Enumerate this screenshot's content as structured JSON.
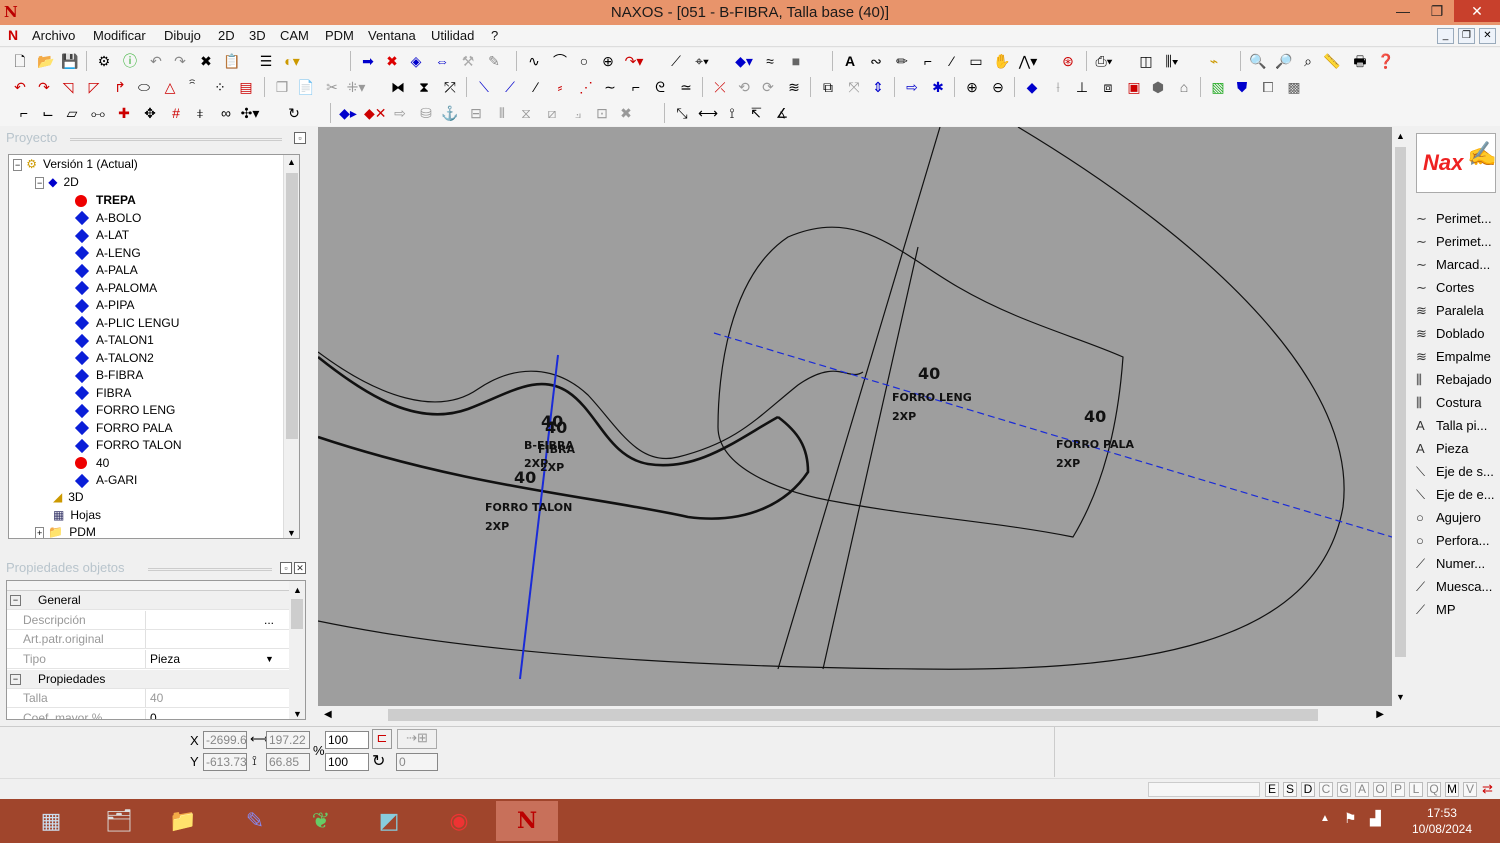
{
  "window": {
    "title": "NAXOS - [051 - B-FIBRA, Talla base (40)]"
  },
  "menu": [
    "Archivo",
    "Modificar",
    "Dibujo",
    "2D",
    "3D",
    "CAM",
    "PDM",
    "Ventana",
    "Utilidad",
    "?"
  ],
  "project_panel": {
    "title": "Proyecto",
    "root": "Versión 1 (Actual)",
    "folder_2d": "2D",
    "items": [
      {
        "label": "TREPA",
        "icon": "red-dot",
        "bold": true
      },
      {
        "label": "A-BOLO",
        "icon": "blue-diamond"
      },
      {
        "label": "A-LAT",
        "icon": "blue-diamond"
      },
      {
        "label": "A-LENG",
        "icon": "blue-diamond"
      },
      {
        "label": "A-PALA",
        "icon": "blue-diamond"
      },
      {
        "label": "A-PALOMA",
        "icon": "blue-diamond"
      },
      {
        "label": "A-PIPA",
        "icon": "blue-diamond"
      },
      {
        "label": "A-PLIC LENGU",
        "icon": "blue-diamond"
      },
      {
        "label": "A-TALON1",
        "icon": "blue-diamond"
      },
      {
        "label": "A-TALON2",
        "icon": "blue-diamond"
      },
      {
        "label": "B-FIBRA",
        "icon": "blue-diamond"
      },
      {
        "label": "FIBRA",
        "icon": "blue-diamond"
      },
      {
        "label": "FORRO LENG",
        "icon": "blue-diamond"
      },
      {
        "label": "FORRO PALA",
        "icon": "blue-diamond"
      },
      {
        "label": "FORRO TALON",
        "icon": "blue-diamond"
      },
      {
        "label": "40",
        "icon": "red-dot"
      },
      {
        "label": "A-GARI",
        "icon": "blue-diamond"
      }
    ],
    "folder_3d": "3D",
    "folder_hojas": "Hojas",
    "folder_pdm": "PDM"
  },
  "properties_panel": {
    "title": "Propiedades objetos",
    "cat_general": "General",
    "desc_label": "Descripción",
    "desc_value": "",
    "desc_btn": "...",
    "art_label": "Art.patr.original",
    "art_value": "",
    "tipo_label": "Tipo",
    "tipo_value": "Pieza",
    "cat_props": "Propiedades",
    "talla_label": "Talla",
    "talla_value": "40",
    "coef_label": "Coef. mayor %",
    "coef_value": "0"
  },
  "canvas_labels": [
    {
      "t1": "40",
      "t2": "B-FIBRA",
      "t3": "2XP"
    },
    {
      "t1": "40",
      "t2": "FIBRA",
      "t3": "2XP"
    },
    {
      "t1": "40",
      "t2": "FORRO TALON",
      "t3": "2XP"
    },
    {
      "t1": "40",
      "t2": "FORRO LENG",
      "t3": "2XP"
    },
    {
      "t1": "40",
      "t2": "FORRO PALA",
      "t3": "2XP"
    }
  ],
  "right_panel": {
    "logo": "Nax",
    "items": [
      {
        "label": "Perimet...",
        "icon": "curve-icon"
      },
      {
        "label": "Perimet...",
        "icon": "curve-icon"
      },
      {
        "label": "Marcad...",
        "icon": "curve-icon"
      },
      {
        "label": "Cortes",
        "icon": "curve-icon"
      },
      {
        "label": "Paralela",
        "icon": "parallel-icon"
      },
      {
        "label": "Doblado",
        "icon": "parallel-icon"
      },
      {
        "label": "Empalme",
        "icon": "parallel-icon"
      },
      {
        "label": "Rebajado",
        "icon": "rebajado-icon"
      },
      {
        "label": "Costura",
        "icon": "costura-icon"
      },
      {
        "label": "Talla pi...",
        "icon": "text-icon"
      },
      {
        "label": "Pieza",
        "icon": "text-icon"
      },
      {
        "label": "Eje de s...",
        "icon": "axis-icon"
      },
      {
        "label": "Eje de e...",
        "icon": "axis-icon"
      },
      {
        "label": "Agujero",
        "icon": "circle-icon"
      },
      {
        "label": "Perfora...",
        "icon": "circle-icon"
      },
      {
        "label": "Numer...",
        "icon": "pen-icon"
      },
      {
        "label": "Muesca...",
        "icon": "pen-icon"
      },
      {
        "label": "MP",
        "icon": "pen-icon"
      }
    ]
  },
  "coords": {
    "x_label": "X",
    "y_label": "Y",
    "x_value": "-2699.6",
    "y_value": "-613.73",
    "w_value": "197.22",
    "h_value": "66.85",
    "pct_label": "%",
    "sx_value": "100",
    "sy_value": "100",
    "rot_value": "0"
  },
  "status_letters": [
    "E",
    "S",
    "D",
    "C",
    "G",
    "A",
    "O",
    "P",
    "L",
    "Q",
    "M",
    "V"
  ],
  "clock": {
    "time": "17:53",
    "date": "10/08/2024"
  }
}
